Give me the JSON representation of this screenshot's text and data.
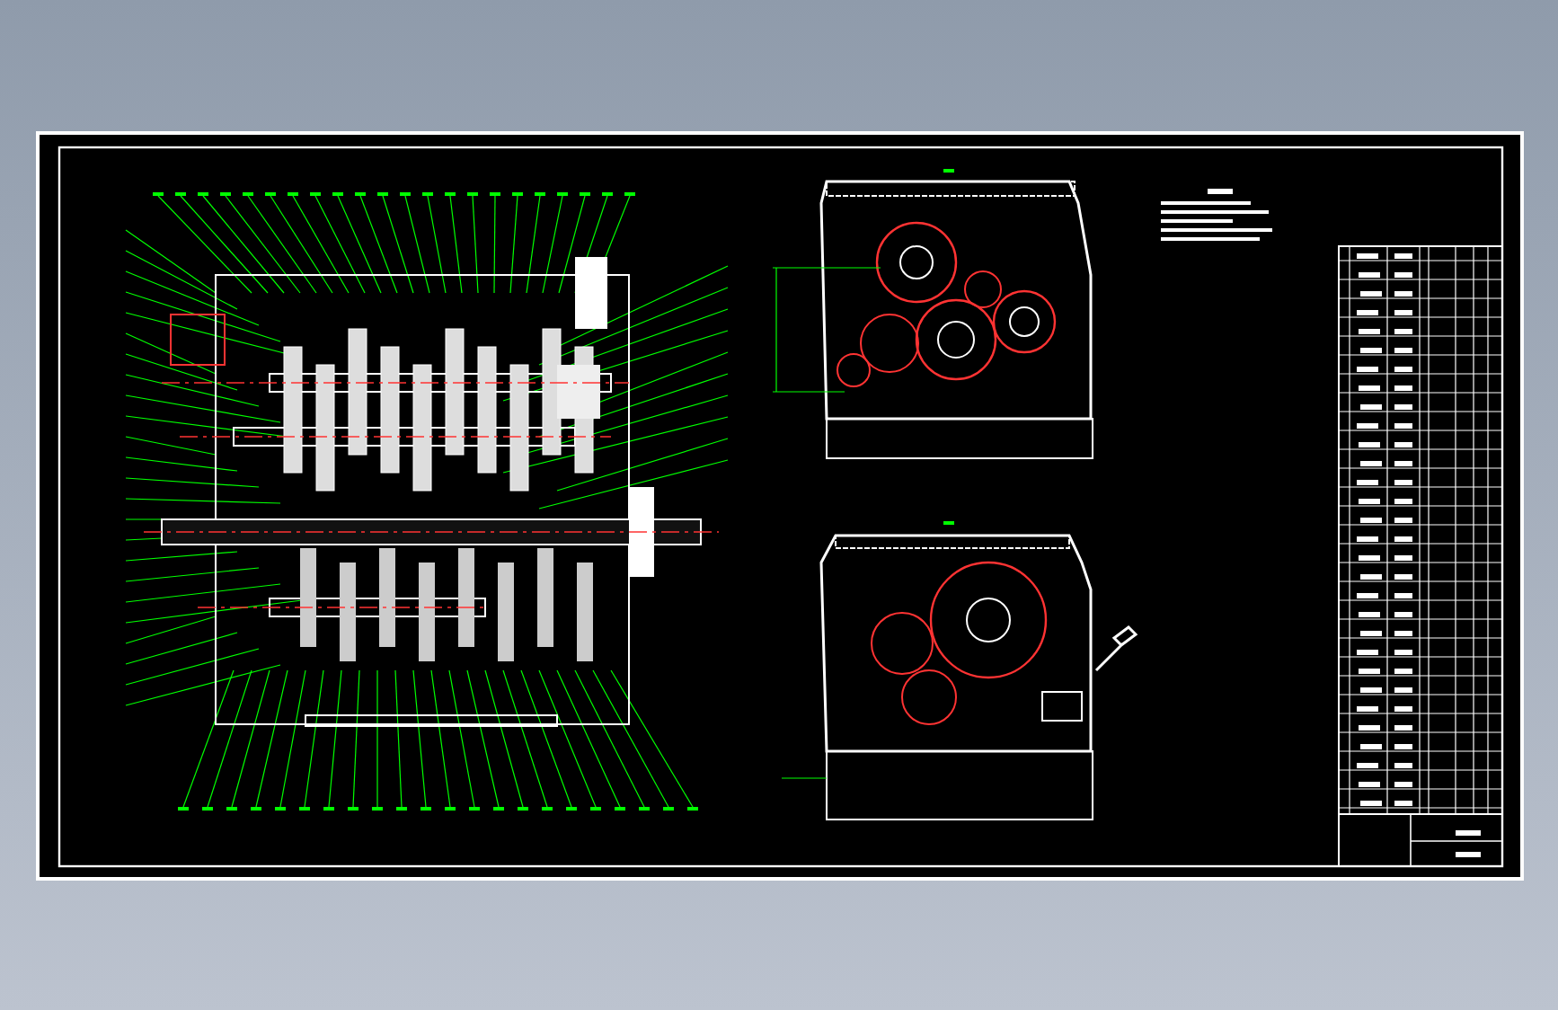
{
  "sheet": {
    "views": [
      {
        "kind": "section"
      },
      {
        "kind": "elevation"
      },
      {
        "kind": "elevation-lever"
      },
      {
        "kind": "notes"
      },
      {
        "kind": "parts-table"
      }
    ]
  }
}
